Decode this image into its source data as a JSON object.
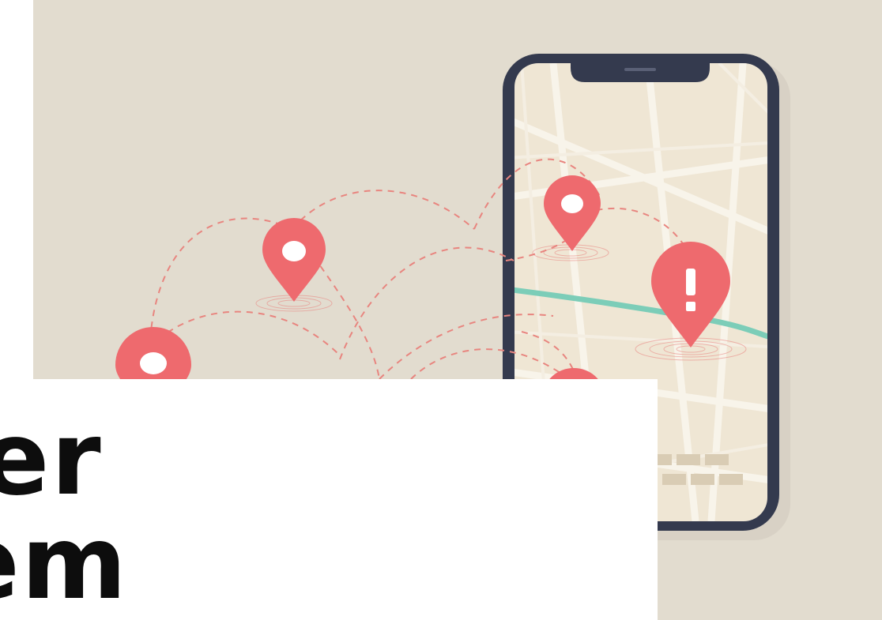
{
  "headline": {
    "line1": "per",
    "line2": "em"
  },
  "illustration": {
    "icons": [
      "location-pin-icon",
      "alert-pin-icon",
      "smartphone-icon",
      "route-path"
    ],
    "colors": {
      "background": "#e2dccf",
      "pin": "#ee6a6e",
      "phone_frame": "#343a4e",
      "map": "#efe6d4",
      "river": "#7ccdb8"
    }
  }
}
